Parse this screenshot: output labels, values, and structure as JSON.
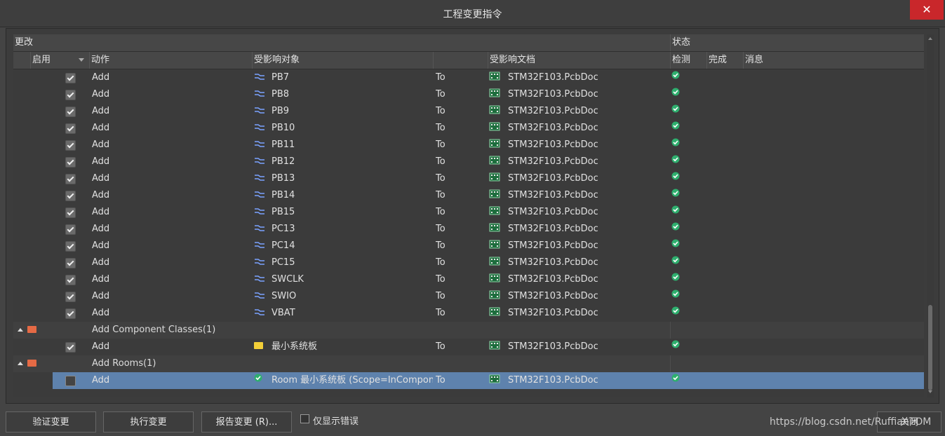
{
  "window": {
    "title": "工程变更指令",
    "close_glyph": "✕"
  },
  "header": {
    "group_changes": "更改",
    "group_status": "状态",
    "col_enable": "启用",
    "col_action": "动作",
    "col_object": "受影响对象",
    "col_document": "受影响文档",
    "col_check": "检测",
    "col_done": "完成",
    "col_message": "消息"
  },
  "rows": [
    {
      "kind": "item",
      "checked": true,
      "action": "Add",
      "icon": "net-icon",
      "object": "PB7",
      "to": "To",
      "document": "STM32F103.PcbDoc",
      "check": "ok"
    },
    {
      "kind": "item",
      "checked": true,
      "action": "Add",
      "icon": "net-icon",
      "object": "PB8",
      "to": "To",
      "document": "STM32F103.PcbDoc",
      "check": "ok"
    },
    {
      "kind": "item",
      "checked": true,
      "action": "Add",
      "icon": "net-icon",
      "object": "PB9",
      "to": "To",
      "document": "STM32F103.PcbDoc",
      "check": "ok"
    },
    {
      "kind": "item",
      "checked": true,
      "action": "Add",
      "icon": "net-icon",
      "object": "PB10",
      "to": "To",
      "document": "STM32F103.PcbDoc",
      "check": "ok"
    },
    {
      "kind": "item",
      "checked": true,
      "action": "Add",
      "icon": "net-icon",
      "object": "PB11",
      "to": "To",
      "document": "STM32F103.PcbDoc",
      "check": "ok"
    },
    {
      "kind": "item",
      "checked": true,
      "action": "Add",
      "icon": "net-icon",
      "object": "PB12",
      "to": "To",
      "document": "STM32F103.PcbDoc",
      "check": "ok"
    },
    {
      "kind": "item",
      "checked": true,
      "action": "Add",
      "icon": "net-icon",
      "object": "PB13",
      "to": "To",
      "document": "STM32F103.PcbDoc",
      "check": "ok"
    },
    {
      "kind": "item",
      "checked": true,
      "action": "Add",
      "icon": "net-icon",
      "object": "PB14",
      "to": "To",
      "document": "STM32F103.PcbDoc",
      "check": "ok"
    },
    {
      "kind": "item",
      "checked": true,
      "action": "Add",
      "icon": "net-icon",
      "object": "PB15",
      "to": "To",
      "document": "STM32F103.PcbDoc",
      "check": "ok"
    },
    {
      "kind": "item",
      "checked": true,
      "action": "Add",
      "icon": "net-icon",
      "object": "PC13",
      "to": "To",
      "document": "STM32F103.PcbDoc",
      "check": "ok"
    },
    {
      "kind": "item",
      "checked": true,
      "action": "Add",
      "icon": "net-icon",
      "object": "PC14",
      "to": "To",
      "document": "STM32F103.PcbDoc",
      "check": "ok"
    },
    {
      "kind": "item",
      "checked": true,
      "action": "Add",
      "icon": "net-icon",
      "object": "PC15",
      "to": "To",
      "document": "STM32F103.PcbDoc",
      "check": "ok"
    },
    {
      "kind": "item",
      "checked": true,
      "action": "Add",
      "icon": "net-icon",
      "object": "SWCLK",
      "to": "To",
      "document": "STM32F103.PcbDoc",
      "check": "ok"
    },
    {
      "kind": "item",
      "checked": true,
      "action": "Add",
      "icon": "net-icon",
      "object": "SWIO",
      "to": "To",
      "document": "STM32F103.PcbDoc",
      "check": "ok"
    },
    {
      "kind": "item",
      "checked": true,
      "action": "Add",
      "icon": "net-icon",
      "object": "VBAT",
      "to": "To",
      "document": "STM32F103.PcbDoc",
      "check": "ok"
    },
    {
      "kind": "group",
      "label": "Add Component Classes(1)"
    },
    {
      "kind": "item",
      "checked": true,
      "action": "Add",
      "icon": "folder-icon",
      "object": "最小系统板",
      "to": "To",
      "document": "STM32F103.PcbDoc",
      "check": "ok"
    },
    {
      "kind": "group",
      "label": "Add Rooms(1)"
    },
    {
      "kind": "item",
      "checked": false,
      "selected": true,
      "action": "Add",
      "icon": "ok-icon",
      "object": "Room 最小系统板 (Scope=InCompon",
      "to": "To",
      "document": "STM32F103.PcbDoc",
      "check": "ok"
    }
  ],
  "buttons": {
    "validate": "验证变更",
    "execute": "执行变更",
    "report": "报告变更 (R)...",
    "close": "关闭"
  },
  "only_errors_label": "仅显示错误",
  "watermark": "https://blog.csdn.net/RuffianTOM",
  "colors": {
    "selected_row": "#5e82ad",
    "ok_green": "#2eaf6e",
    "close_red": "#c9272b"
  }
}
